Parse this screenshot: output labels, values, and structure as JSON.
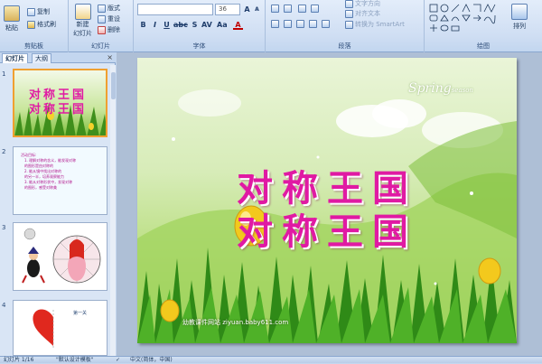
{
  "ribbon": {
    "clipboard": {
      "paste": "粘贴",
      "copy": "复制",
      "format_painter": "格式刷",
      "group_label": "剪贴板"
    },
    "slides": {
      "new_slide_line1": "新建",
      "new_slide_line2": "幻灯片",
      "layout": "版式",
      "reset": "重设",
      "delete": "删除",
      "group_label": "幻灯片"
    },
    "font": {
      "font_name": "",
      "font_size": "36",
      "group_label": "字体"
    },
    "paragraph": {
      "text_direction": "文字方向",
      "align_text": "对齐文本",
      "smartart": "转换为 SmartArt",
      "group_label": "段落"
    },
    "drawing": {
      "arrange": "排列",
      "group_label": "绘图"
    }
  },
  "left_pane": {
    "tab_slides": "幻灯片",
    "tab_outline": "大纲",
    "close": "×",
    "thumbs": [
      {
        "num": "1",
        "title": "对称王国"
      },
      {
        "num": "2",
        "heading": "活动目标:",
        "lines": [
          "1. 理解对称的含义，能发现对称",
          "的图形是由对称的",
          "2. 能从镜中找出对称的",
          "的另一半，培养观察能力",
          "3. 能从对称形状中，发现对称",
          "的图形，感受对称美"
        ]
      },
      {
        "num": "3"
      },
      {
        "num": "4",
        "label": "第一关"
      }
    ]
  },
  "slide": {
    "title_line1": "对称王国",
    "title_line2": "对称王国",
    "spring_text": "Spring",
    "spring_small": "season",
    "watermark": "幼教课件网站  ziyuan.baby611.com"
  },
  "status_bar": {
    "slide_info": "幻灯片 1/16",
    "theme": "\"默认设计模板\"",
    "language": "中文(简体，中国)"
  },
  "colors": {
    "title": "#e01aa3",
    "selection": "#f0a030",
    "ribbon": "#cfdef3"
  }
}
